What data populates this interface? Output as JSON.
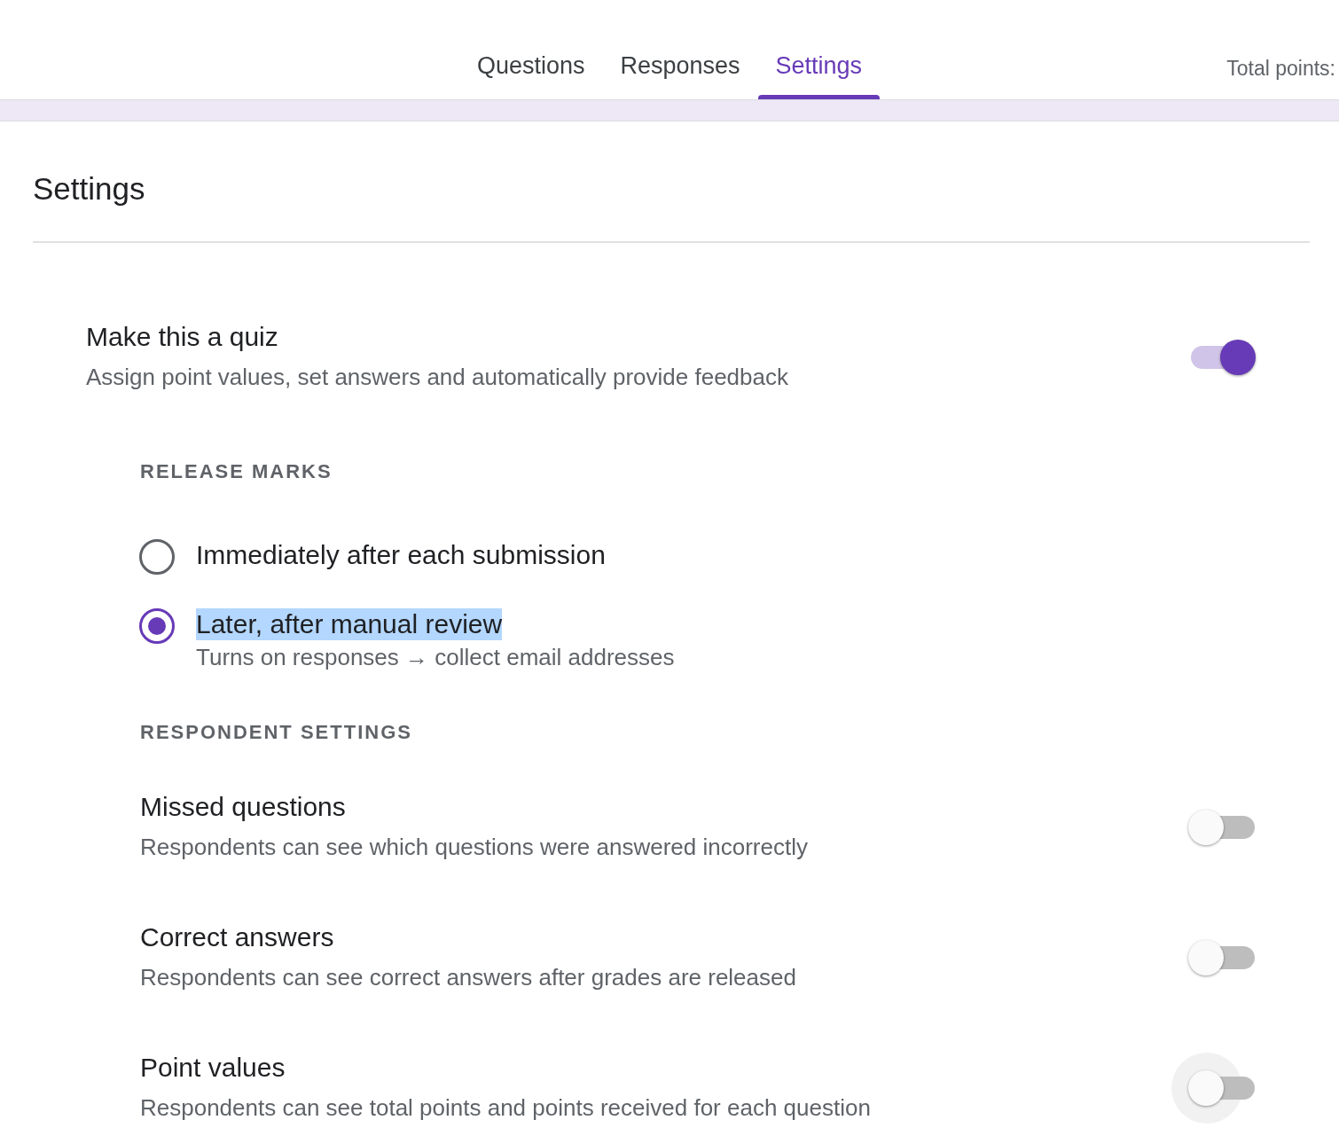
{
  "tabs": [
    {
      "label": "Questions",
      "selected": false
    },
    {
      "label": "Responses",
      "selected": false
    },
    {
      "label": "Settings",
      "selected": true
    }
  ],
  "total_points": "Total points:",
  "heading": "Settings",
  "quiz": {
    "title": "Make this a quiz",
    "description": "Assign point values, set answers and automatically provide feedback",
    "on": true,
    "focus_ring": false
  },
  "sections": [
    {
      "title": "RELEASE MARKS",
      "items": [
        {
          "kind": "radio",
          "label": "Immediately after each submission",
          "selected": false,
          "highlighted": false
        },
        {
          "kind": "radio",
          "label": "Later, after manual review",
          "selected": true,
          "highlighted": true,
          "description": "Turns on responses → collect email addresses"
        }
      ]
    },
    {
      "title": "RESPONDENT SETTINGS",
      "items": [
        {
          "kind": "toggle",
          "label": "Missed questions",
          "description": "Respondents can see which questions were answered incorrectly",
          "on": false,
          "focus_ring": false
        },
        {
          "kind": "toggle",
          "label": "Correct answers",
          "description": "Respondents can see correct answers after grades are released",
          "on": false,
          "focus_ring": false
        },
        {
          "kind": "toggle",
          "label": "Point values",
          "description": "Respondents can see total points and points received for each question",
          "on": false,
          "focus_ring": true
        }
      ]
    }
  ]
}
